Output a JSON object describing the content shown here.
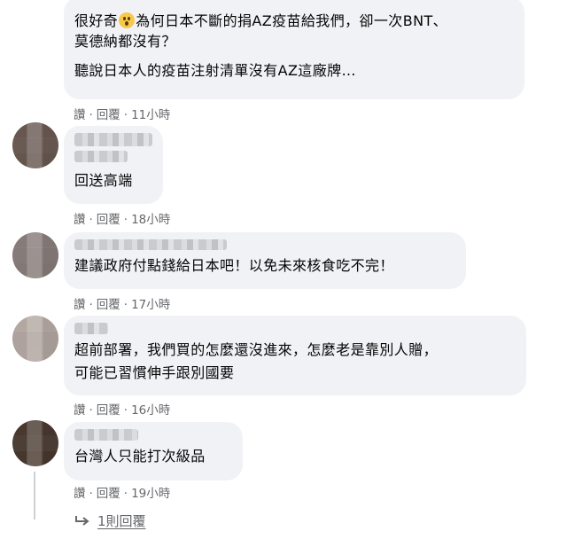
{
  "comments": [
    {
      "lines": [
        "很好奇",
        "為何日本不斷的捐AZ疫苗給我們，卻一次BNT、",
        "莫德納都沒有？",
        "聽說日本人的疫苗注射清單沒有AZ這廠牌…"
      ],
      "read": "讚",
      "reply": "回覆",
      "time": "11小時"
    },
    {
      "lines": [
        "回送高端"
      ],
      "read": "讚",
      "reply": "回覆",
      "time": "18小時"
    },
    {
      "lines": [
        "建議政府付點錢給日本吧！以免未來核食吃不完！"
      ],
      "read": "讚",
      "reply": "回覆",
      "time": "17小時"
    },
    {
      "lines": [
        "超前部署，我們買的怎麼還沒進來，怎麼老是靠別人贈，",
        "可能已習慣伸手跟別國要"
      ],
      "read": "讚",
      "reply": "回覆",
      "time": "16小時"
    },
    {
      "lines": [
        "台灣人只能打次級品"
      ],
      "read": "讚",
      "reply": "回覆",
      "time": "19小時"
    }
  ],
  "replies_link": "1則回覆",
  "colors": {
    "bubble": "#f0f2f5",
    "meta_text": "#65676b",
    "text": "#050505",
    "avatar_2": "#6b5a52",
    "avatar_3": "#8a7f7c",
    "avatar_4": "#b9aca6",
    "avatar_5": "#4a3a30"
  },
  "icons": {
    "emoji": "astonished-face-icon",
    "reply_arrow": "reply-arrow-icon"
  }
}
